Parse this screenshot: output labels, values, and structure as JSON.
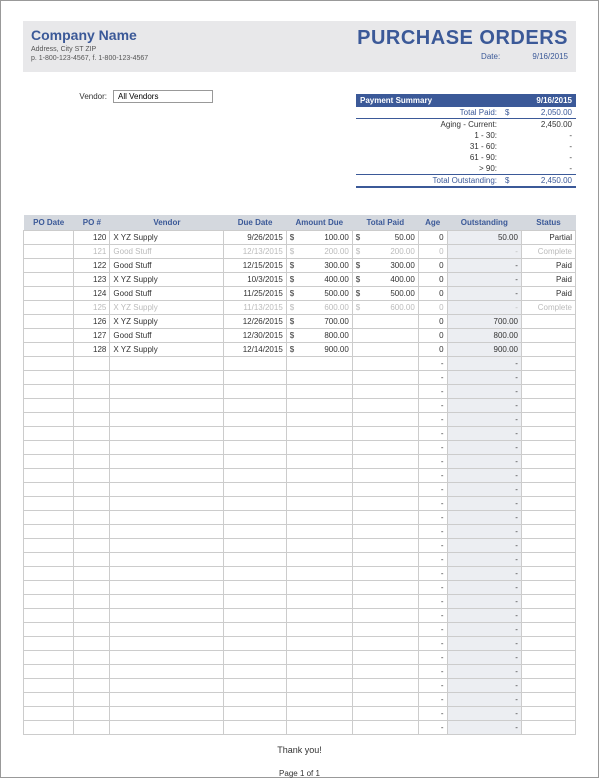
{
  "header": {
    "company_name": "Company Name",
    "address": "Address, City ST ZIP",
    "phone": "p. 1-800-123-4567, f. 1-800-123-4567",
    "title": "PURCHASE ORDERS",
    "date_label": "Date:",
    "date_value": "9/16/2015"
  },
  "vendor": {
    "label": "Vendor:",
    "value": "All Vendors"
  },
  "payment_summary": {
    "heading": "Payment Summary",
    "heading_date": "9/16/2015",
    "total_paid_label": "Total Paid:",
    "total_paid_cur": "$",
    "total_paid_val": "2,050.00",
    "aging_current_label": "Aging - Current:",
    "aging_current_val": "2,450.00",
    "r1_label": "1 - 30:",
    "r1_val": "-",
    "r2_label": "31 - 60:",
    "r2_val": "-",
    "r3_label": "61 - 90:",
    "r3_val": "-",
    "r4_label": "> 90:",
    "r4_val": "-",
    "total_out_label": "Total Outstanding:",
    "total_out_cur": "$",
    "total_out_val": "2,450.00"
  },
  "columns": {
    "po_date": "PO Date",
    "po_num": "PO #",
    "vendor": "Vendor",
    "due_date": "Due Date",
    "amount_due": "Amount Due",
    "total_paid": "Total Paid",
    "age": "Age",
    "outstanding": "Outstanding",
    "status": "Status"
  },
  "rows": [
    {
      "po_date": "",
      "po_num": "120",
      "vendor": "X YZ Supply",
      "due_date": "9/26/2015",
      "amt_cur": "$",
      "amt_val": "100.00",
      "paid_cur": "$",
      "paid_val": "50.00",
      "age": "0",
      "out": "50.00",
      "status": "Partial",
      "faded": false
    },
    {
      "po_date": "",
      "po_num": "121",
      "vendor": "Good Stuff",
      "due_date": "12/13/2015",
      "amt_cur": "$",
      "amt_val": "200.00",
      "paid_cur": "$",
      "paid_val": "200.00",
      "age": "0",
      "out": "-",
      "status": "Complete",
      "faded": true
    },
    {
      "po_date": "",
      "po_num": "122",
      "vendor": "Good Stuff",
      "due_date": "12/15/2015",
      "amt_cur": "$",
      "amt_val": "300.00",
      "paid_cur": "$",
      "paid_val": "300.00",
      "age": "0",
      "out": "-",
      "status": "Paid",
      "faded": false
    },
    {
      "po_date": "",
      "po_num": "123",
      "vendor": "X YZ Supply",
      "due_date": "10/3/2015",
      "amt_cur": "$",
      "amt_val": "400.00",
      "paid_cur": "$",
      "paid_val": "400.00",
      "age": "0",
      "out": "-",
      "status": "Paid",
      "faded": false
    },
    {
      "po_date": "",
      "po_num": "124",
      "vendor": "Good Stuff",
      "due_date": "11/25/2015",
      "amt_cur": "$",
      "amt_val": "500.00",
      "paid_cur": "$",
      "paid_val": "500.00",
      "age": "0",
      "out": "-",
      "status": "Paid",
      "faded": false
    },
    {
      "po_date": "",
      "po_num": "125",
      "vendor": "X YZ Supply",
      "due_date": "11/13/2015",
      "amt_cur": "$",
      "amt_val": "600.00",
      "paid_cur": "$",
      "paid_val": "600.00",
      "age": "0",
      "out": "-",
      "status": "Complete",
      "faded": true
    },
    {
      "po_date": "",
      "po_num": "126",
      "vendor": "X YZ Supply",
      "due_date": "12/26/2015",
      "amt_cur": "$",
      "amt_val": "700.00",
      "paid_cur": "",
      "paid_val": "",
      "age": "0",
      "out": "700.00",
      "status": "",
      "faded": false
    },
    {
      "po_date": "",
      "po_num": "127",
      "vendor": "Good Stuff",
      "due_date": "12/30/2015",
      "amt_cur": "$",
      "amt_val": "800.00",
      "paid_cur": "",
      "paid_val": "",
      "age": "0",
      "out": "800.00",
      "status": "",
      "faded": false
    },
    {
      "po_date": "",
      "po_num": "128",
      "vendor": "X YZ Supply",
      "due_date": "12/14/2015",
      "amt_cur": "$",
      "amt_val": "900.00",
      "paid_cur": "",
      "paid_val": "",
      "age": "0",
      "out": "900.00",
      "status": "",
      "faded": false
    }
  ],
  "empty_rows": 27,
  "footer": {
    "thanks": "Thank you!",
    "page": "Page 1 of 1"
  }
}
